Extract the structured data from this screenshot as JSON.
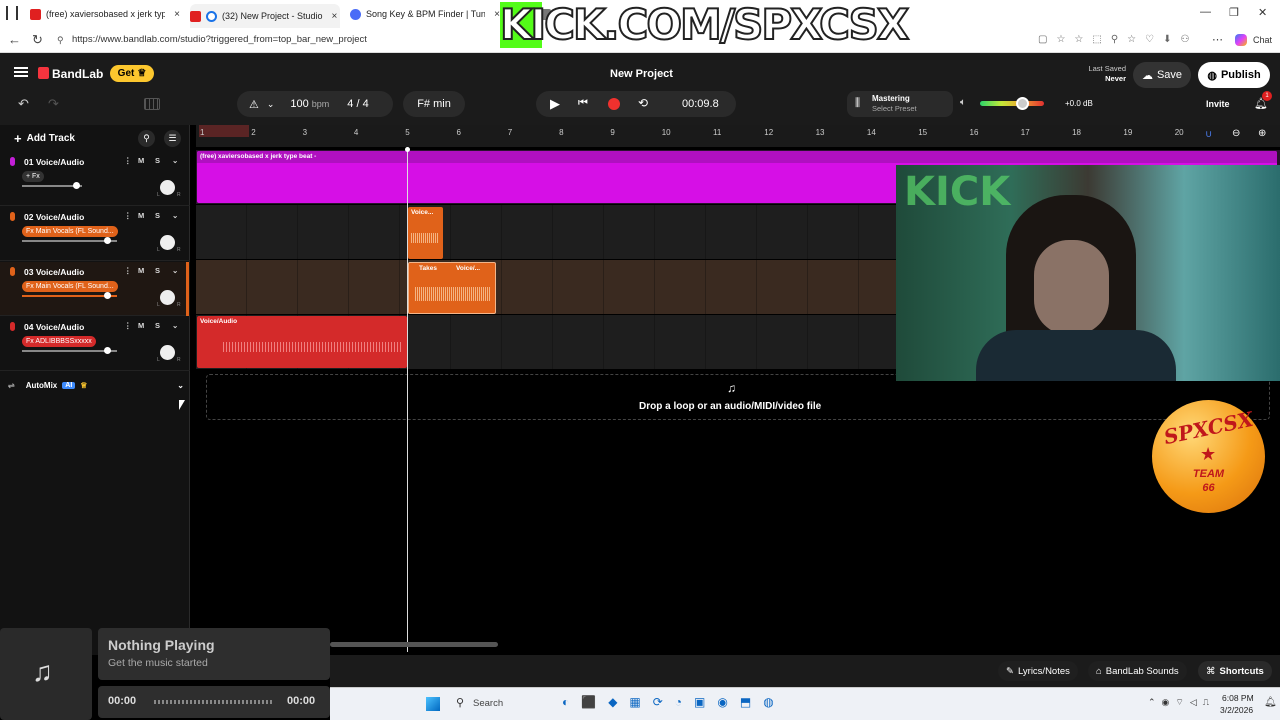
{
  "browser": {
    "tabs": [
      {
        "title": "(free) xaviersobased x jerk type be",
        "color": "#e02020"
      },
      {
        "title": "(32) New Project - Studio",
        "color": "#e02020"
      },
      {
        "title": "Song Key & BPM Finder | Tunebat",
        "color": "#4a6cf7"
      }
    ],
    "partial_tab": "be",
    "url": "https://www.bandlab.com/studio?triggered_from=top_bar_new_project",
    "chat_label": "Chat"
  },
  "overlay": {
    "kick_text": "KICK.COM/SPXCSX",
    "badge_line1": "SPXCSX",
    "badge_line2": "TEAM",
    "badge_line3": "66",
    "webcam_kick": "KICK"
  },
  "header": {
    "brand": "BandLab",
    "get_label": "Get",
    "project_title": "New Project",
    "last_saved_label": "Last Saved",
    "last_saved_value": "Never",
    "save_label": "Save",
    "publish_label": "Publish",
    "bpm_value": "100",
    "bpm_unit": "bpm",
    "time_signature": "4 / 4",
    "key": "F# min",
    "time_display": "00:09.8",
    "mastering_label": "Mastering",
    "mastering_preset": "Select Preset",
    "db_value": "+0.0 dB",
    "invite_label": "Invite",
    "notif_count": "1"
  },
  "left": {
    "add_track_label": "Add Track",
    "tracks": [
      {
        "name": "01  Voice/Audio",
        "fx": "+ Fx",
        "fx_color": "#333",
        "color": "#c21fd6"
      },
      {
        "name": "02  Voice/Audio",
        "fx": "Fx Main Vocals (FL Sound...",
        "fx_color": "#e0621a",
        "color": "#e0621a"
      },
      {
        "name": "03  Voice/Audio",
        "fx": "Fx Main Vocals (FL Sound...",
        "fx_color": "#e0621a",
        "color": "#e0621a"
      },
      {
        "name": "04  Voice/Audio",
        "fx": "Fx ADLIBBBSSxxxxx",
        "fx_color": "#d42a2a",
        "color": "#d42a2a"
      }
    ],
    "m_label": "M",
    "s_label": "S",
    "l_label": "L",
    "r_label": "R",
    "automix_label": "AutoMix",
    "ai_label": "AI"
  },
  "timeline": {
    "ruler": [
      "1",
      "2",
      "3",
      "4",
      "5",
      "6",
      "7",
      "8",
      "9",
      "10",
      "11",
      "12",
      "13",
      "14",
      "15",
      "16",
      "17",
      "18",
      "19",
      "20"
    ],
    "clip1_label": "(free) xaviersobased x jerk type beat -",
    "clip2_label": "Voice...",
    "clip3_takes": "Takes",
    "clip3_label": "Voice/...",
    "clip4_label": "Voice/Audio",
    "drop_text": "Drop a loop or an audio/MIDI/video file"
  },
  "player": {
    "title": "Nothing Playing",
    "subtitle": "Get the music started",
    "time_start": "00:00",
    "time_end": "00:00"
  },
  "bottom": {
    "lyrics_label": "Lyrics/Notes",
    "sounds_label": "BandLab Sounds",
    "shortcuts_label": "Shortcuts"
  },
  "taskbar": {
    "search_label": "Search",
    "time": "6:08 PM",
    "date": "3/2/2026"
  }
}
